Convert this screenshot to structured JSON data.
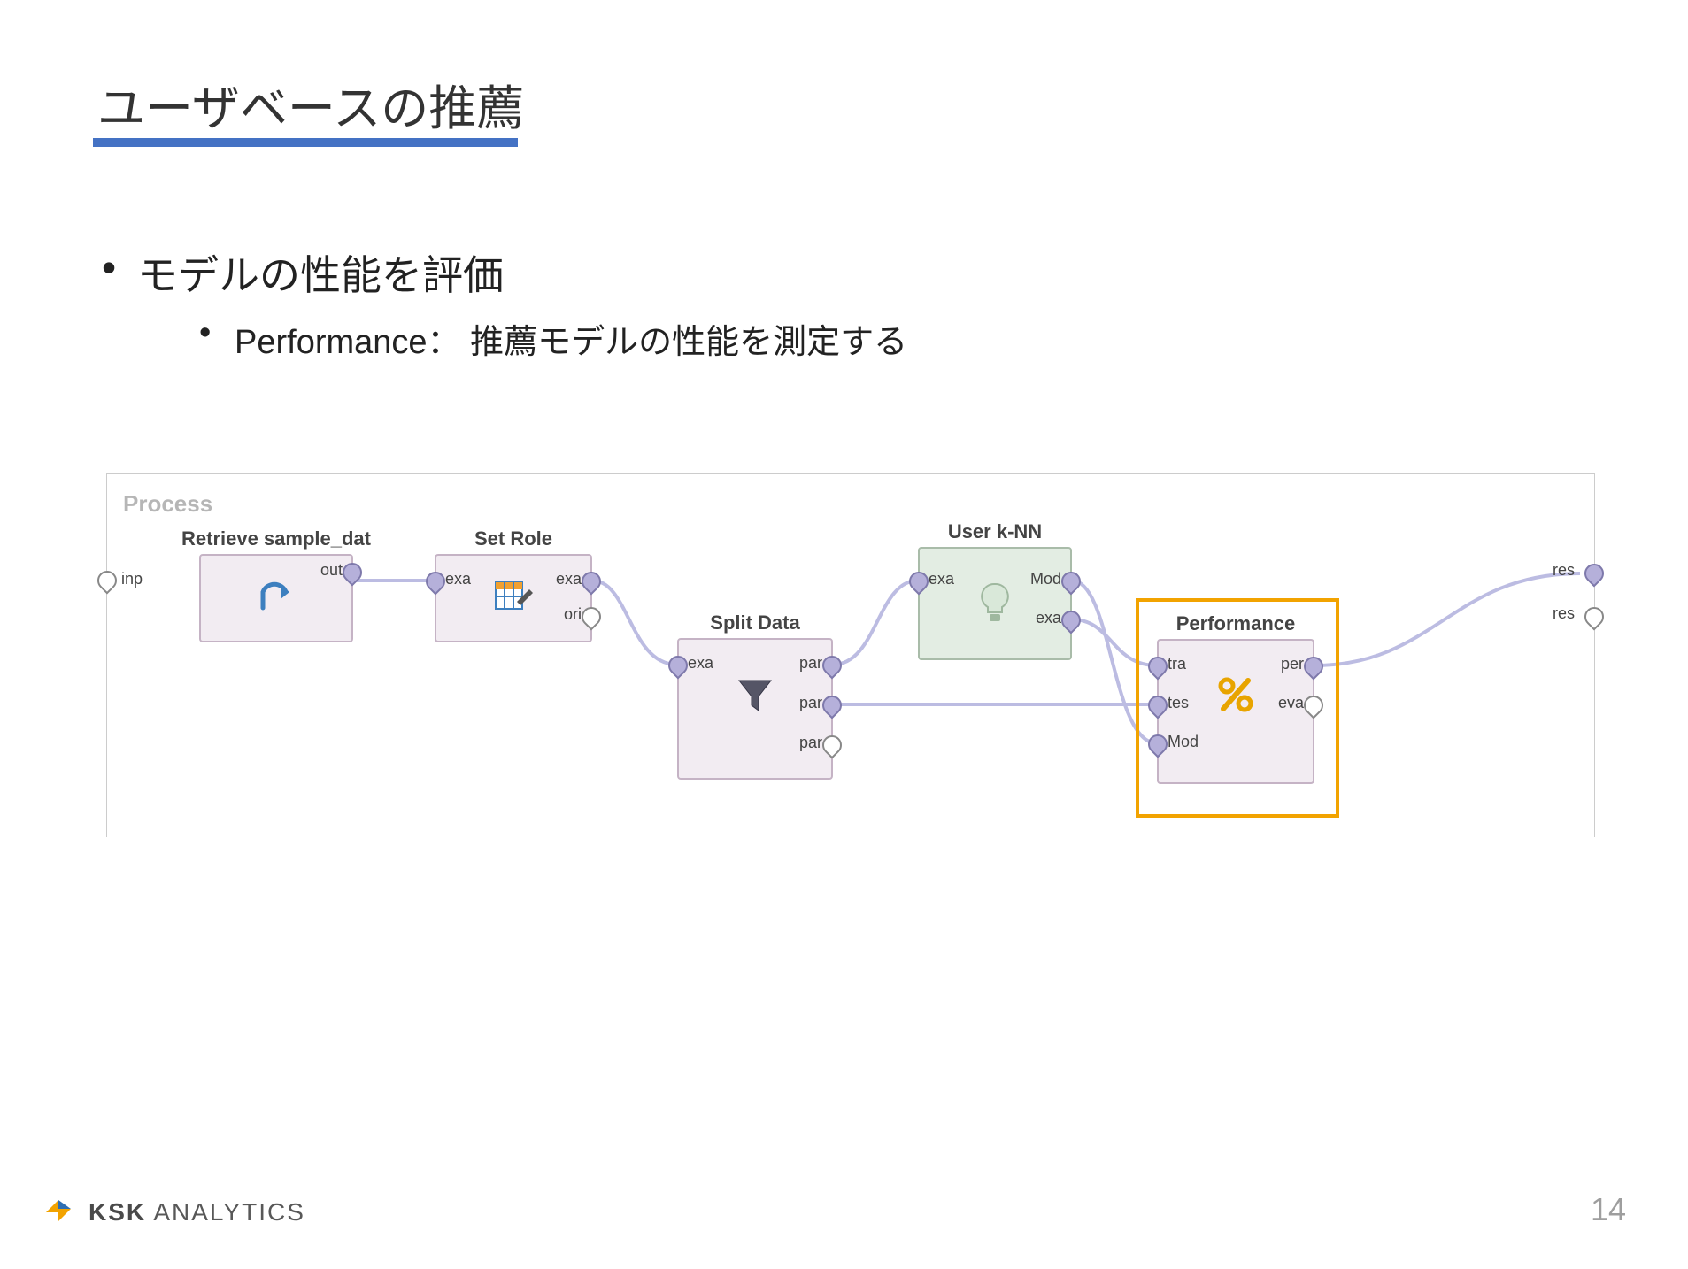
{
  "title": "ユーザベースの推薦",
  "bullet_main": "モデルの性能を評価",
  "bullet_sub": "Performance： 推薦モデルの性能を測定する",
  "process": {
    "label": "Process",
    "start_port_label": "inp",
    "end_port_labels": [
      "res",
      "res"
    ],
    "nodes": {
      "retrieve": {
        "title": "Retrieve sample_dat",
        "out_label": "out"
      },
      "set_role": {
        "title": "Set Role",
        "in_label": "exa",
        "out_labels": [
          "exa",
          "ori"
        ]
      },
      "split": {
        "title": "Split Data",
        "in_label": "exa",
        "out_labels": [
          "par",
          "par",
          "par"
        ]
      },
      "knn": {
        "title": "User k-NN",
        "in_label": "exa",
        "out_labels": [
          "Mod",
          "exa"
        ]
      },
      "perf": {
        "title": "Performance",
        "in_labels": [
          "tra",
          "tes",
          "Mod"
        ],
        "out_labels": [
          "per",
          "eva"
        ]
      }
    }
  },
  "footer": {
    "brand_bold": "KSK",
    "brand_rest": " ANALYTICS",
    "page": "14"
  }
}
